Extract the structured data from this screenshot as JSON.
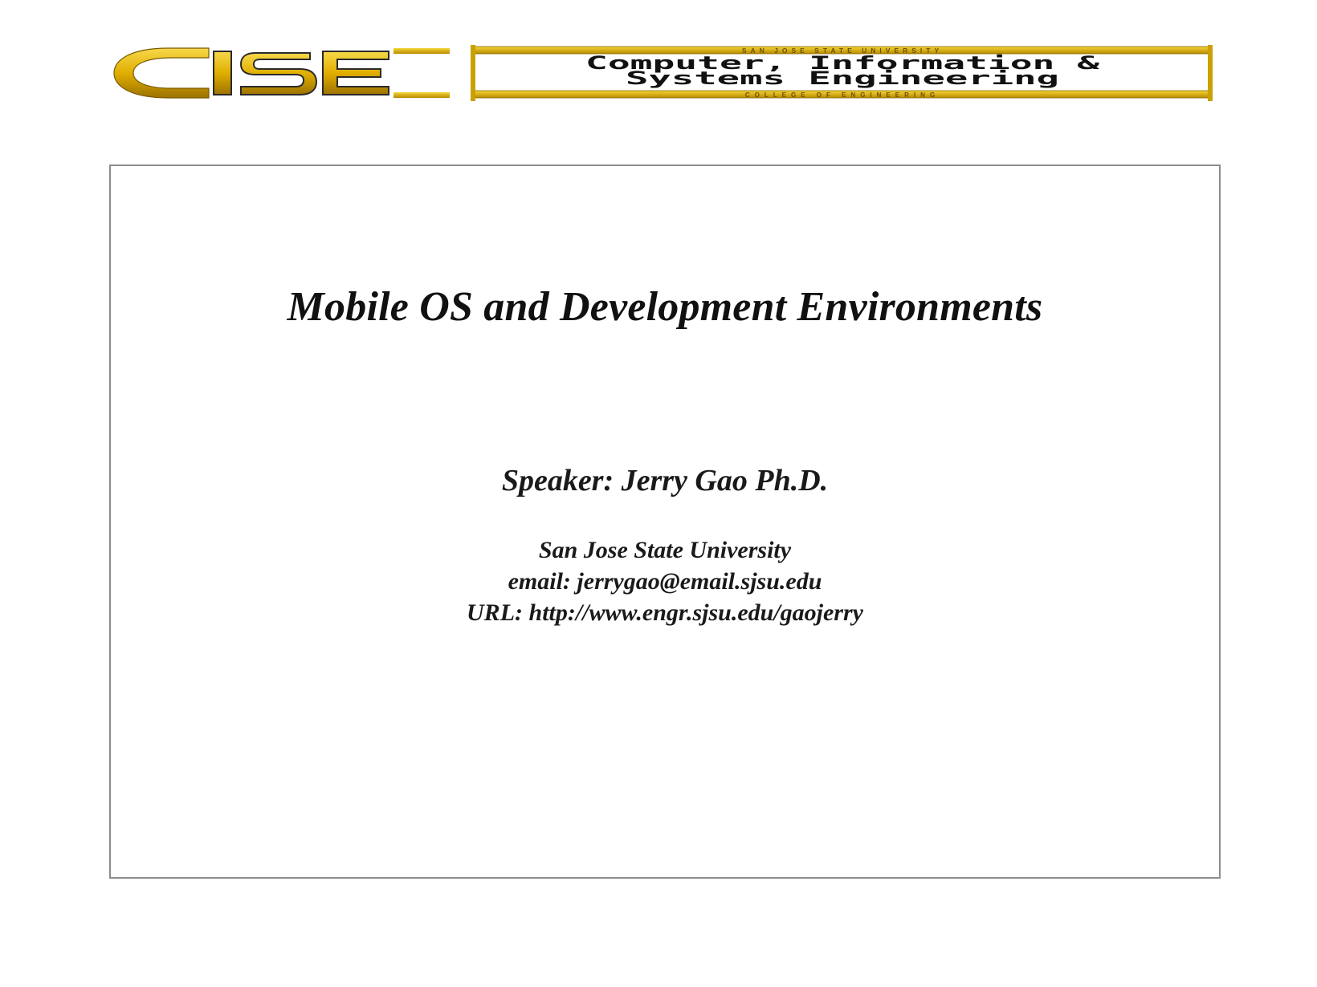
{
  "logo": {
    "acronym": "CISE",
    "university": "SAN JOSE STATE UNIVERSITY",
    "name_line1": "Computer, Information &",
    "name_line2": "Systems Engineering",
    "college": "COLLEGE OF ENGINEERING",
    "colors": {
      "gold": "#e3b300",
      "gold_dark": "#a07600",
      "black": "#111111"
    }
  },
  "slide": {
    "title": "Mobile OS and Development Environments",
    "speaker": "Speaker: Jerry Gao Ph.D.",
    "affiliation": "San Jose State University",
    "email": "email: jerrygao@email.sjsu.edu",
    "url": "URL: http://www.engr.sjsu.edu/gaojerry"
  }
}
